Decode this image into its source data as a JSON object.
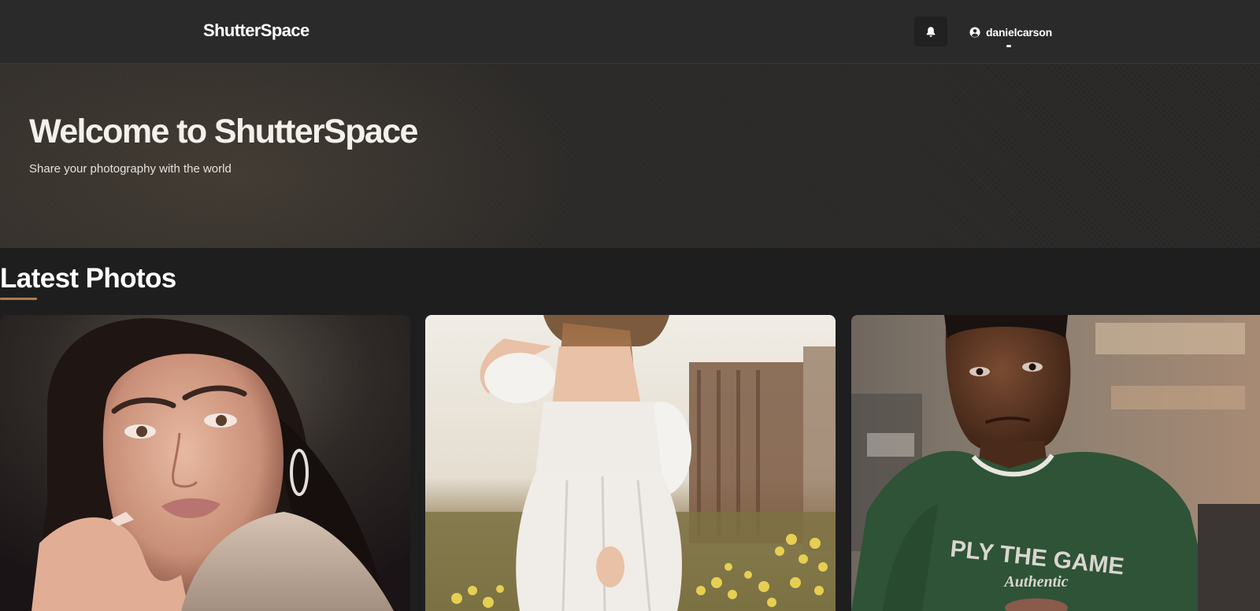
{
  "header": {
    "brand": "ShutterSpace",
    "notification_icon": "bell-icon",
    "user_icon": "user-circle-icon",
    "username": "danielcarson"
  },
  "hero": {
    "title": "Welcome to ShutterSpace",
    "subtitle": "Share your photography with the world"
  },
  "latest": {
    "title": "Latest Photos",
    "accent_color": "#b07c4a",
    "photos": [
      {
        "subject": "portrait-woman-dark-hair"
      },
      {
        "subject": "woman-white-dress-field"
      },
      {
        "subject": "man-green-sweatshirt"
      }
    ],
    "photo3_shirt_text": [
      "PLY THE GAME",
      "Authentic"
    ]
  },
  "colors": {
    "header_bg": "#2b2a2a",
    "page_bg": "#1e1e1f",
    "text": "#ffffff"
  }
}
